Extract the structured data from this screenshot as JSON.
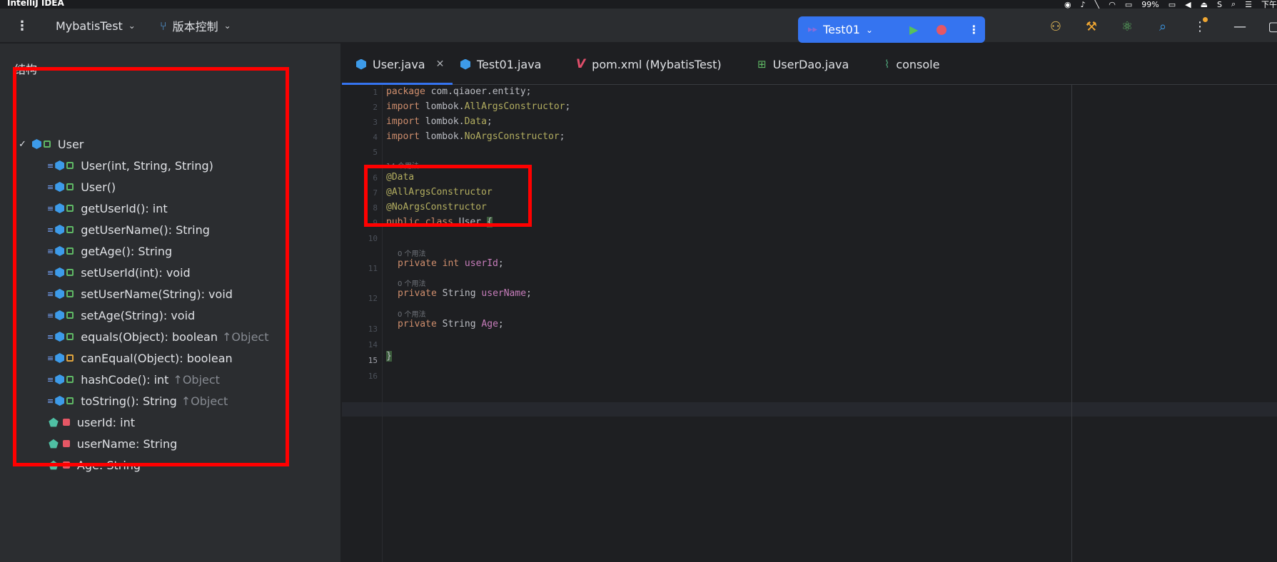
{
  "menubar": {
    "app_name": "IntelliJ IDEA",
    "battery": "99%",
    "clock_partial": "下午"
  },
  "toolbar": {
    "project_name": "MybatisTest",
    "vcs_label": "版本控制",
    "run_config": "Test01",
    "accent": "#3574f0"
  },
  "structure": {
    "title": "结构",
    "root": "User",
    "items": [
      {
        "label": "User(int, String, String)",
        "inherit": "",
        "kind": "method",
        "access": "public"
      },
      {
        "label": "User()",
        "inherit": "",
        "kind": "method",
        "access": "public"
      },
      {
        "label": "getUserId(): int",
        "inherit": "",
        "kind": "method",
        "access": "public"
      },
      {
        "label": "getUserName(): String",
        "inherit": "",
        "kind": "method",
        "access": "public"
      },
      {
        "label": "getAge(): String",
        "inherit": "",
        "kind": "method",
        "access": "public"
      },
      {
        "label": "setUserId(int): void",
        "inherit": "",
        "kind": "method",
        "access": "public"
      },
      {
        "label": "setUserName(String): void",
        "inherit": "",
        "kind": "method",
        "access": "public"
      },
      {
        "label": "setAge(String): void",
        "inherit": "",
        "kind": "method",
        "access": "public"
      },
      {
        "label": "equals(Object): boolean",
        "inherit": "↑Object",
        "kind": "method",
        "access": "public"
      },
      {
        "label": "canEqual(Object): boolean",
        "inherit": "",
        "kind": "method",
        "access": "protected"
      },
      {
        "label": "hashCode(): int",
        "inherit": "↑Object",
        "kind": "method",
        "access": "public"
      },
      {
        "label": "toString(): String",
        "inherit": "↑Object",
        "kind": "method",
        "access": "public"
      },
      {
        "label": "userId: int",
        "inherit": "",
        "kind": "field",
        "access": "private"
      },
      {
        "label": "userName: String",
        "inherit": "",
        "kind": "field",
        "access": "private"
      },
      {
        "label": "Age: String",
        "inherit": "",
        "kind": "field",
        "access": "private"
      }
    ]
  },
  "editor": {
    "tabs": [
      {
        "label": "User.java",
        "active": true
      },
      {
        "label": "Test01.java",
        "active": false
      },
      {
        "label": "pom.xml (MybatisTest)",
        "active": false
      },
      {
        "label": "UserDao.java",
        "active": false
      },
      {
        "label": "console",
        "active": false
      }
    ],
    "hints": {
      "class_usages": "14 个用法",
      "f1": "0 个用法",
      "f2": "0 个用法",
      "f3": "0 个用法"
    },
    "lines": {
      "l1": [
        "package",
        " com.qiaoer.entity;"
      ],
      "l2": [
        "import",
        " lombok.",
        "AllArgsConstructor",
        ";"
      ],
      "l3": [
        "import",
        " lombok.",
        "Data",
        ";"
      ],
      "l4": [
        "import",
        " lombok.",
        "NoArgsConstructor",
        ";"
      ],
      "l6": "@Data",
      "l7": "@AllArgsConstructor",
      "l8": "@NoArgsConstructor",
      "l9": [
        "public class",
        " User ",
        "{"
      ],
      "l11": [
        "private int",
        " ",
        "userId",
        ";"
      ],
      "l12": [
        "private",
        " String ",
        "userName",
        ";"
      ],
      "l13": [
        "private",
        " String ",
        "Age",
        ";"
      ],
      "l15": "}"
    },
    "line_numbers": [
      "1",
      "2",
      "3",
      "4",
      "5",
      "6",
      "7",
      "8",
      "9",
      "10",
      "11",
      "12",
      "13",
      "14",
      "15",
      "16"
    ]
  }
}
